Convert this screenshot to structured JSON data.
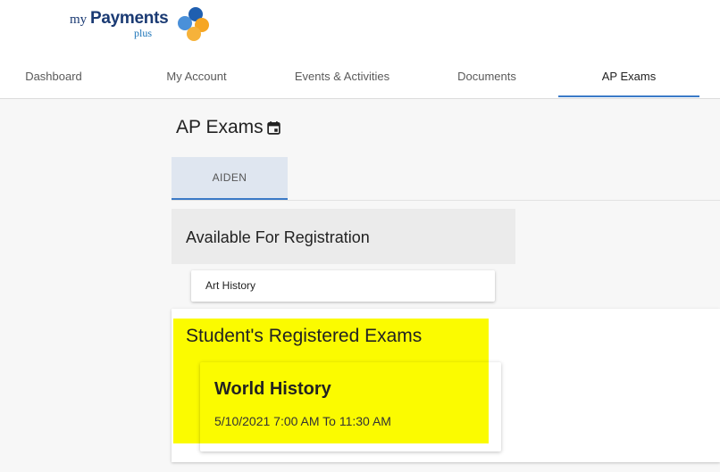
{
  "header": {
    "logo": {
      "my": "my",
      "payments": "Payments",
      "plus": "plus"
    }
  },
  "nav": {
    "items": [
      {
        "label": "Dashboard"
      },
      {
        "label": "My Account"
      },
      {
        "label": "Events & Activities"
      },
      {
        "label": "Documents"
      },
      {
        "label": "AP Exams",
        "active": true
      }
    ],
    "accent_color": "#3b7ac7"
  },
  "page": {
    "title": "AP Exams",
    "title_icon": "calendar-icon",
    "student_tab": "AIDEN",
    "available": {
      "title": "Available For Registration",
      "exams": [
        {
          "label": "Art History"
        }
      ]
    },
    "registered": {
      "title": "Student's Registered Exams",
      "highlight_color": "#fbfb00",
      "exams": [
        {
          "name": "World History",
          "time": "5/10/2021 7:00 AM To 11:30 AM"
        }
      ]
    }
  }
}
